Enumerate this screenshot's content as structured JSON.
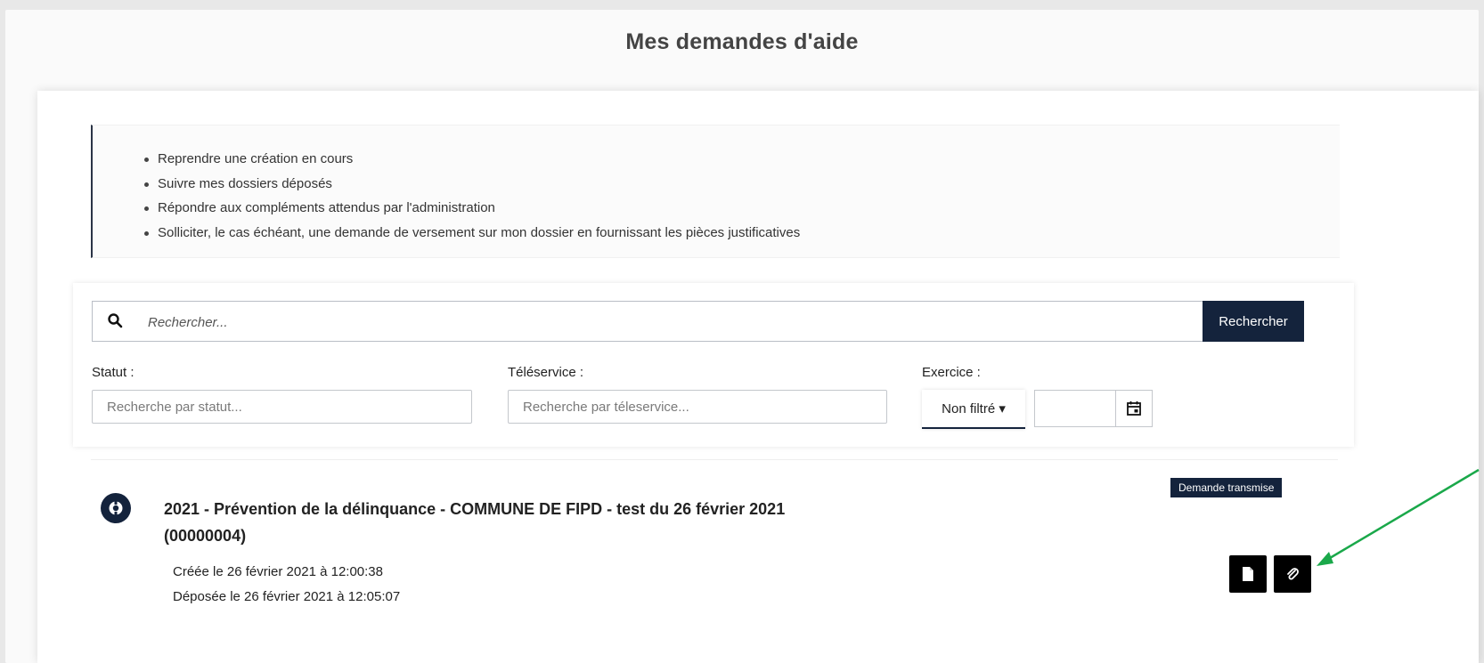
{
  "page": {
    "title": "Mes demandes d'aide"
  },
  "info": {
    "items": [
      "Reprendre une création en cours",
      "Suivre mes dossiers déposés",
      "Répondre aux compléments attendus par l'administration",
      "Solliciter, le cas échéant, une demande de versement sur mon dossier en fournissant les pièces justificatives"
    ]
  },
  "search": {
    "placeholder": "Rechercher...",
    "button_label": "Rechercher",
    "icon": "search-icon"
  },
  "filters": {
    "statut": {
      "label": "Statut :",
      "placeholder": "Recherche par statut..."
    },
    "teleservice": {
      "label": "Téléservice :",
      "placeholder": "Recherche par téleservice..."
    },
    "exercice": {
      "label": "Exercice :",
      "selected": "Non filtré ▾",
      "calendar_icon": "calendar-icon"
    }
  },
  "results": [
    {
      "badge": "Demande transmise",
      "title": "2021 - Prévention de la délinquance - COMMUNE DE FIPD - test du 26 février 2021 (00000004)",
      "created": "Créée le 26 février 2021 à 12:00:38",
      "submitted": "Déposée le 26 février 2021 à 12:05:07",
      "icons": [
        "dossier-icon",
        "document-icon",
        "paperclip-icon"
      ]
    }
  ],
  "colors": {
    "primary": "#14233c",
    "annotation_arrow": "#1aa84a"
  }
}
